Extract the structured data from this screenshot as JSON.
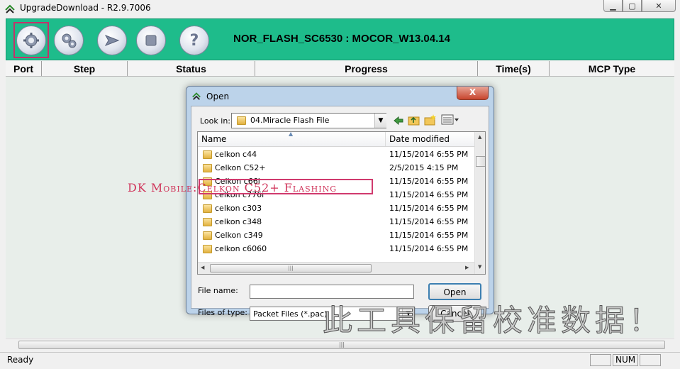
{
  "window": {
    "title": "UpgradeDownload - R2.9.7006",
    "min_label": "▁",
    "max_label": "▢",
    "close_label": "✕"
  },
  "toolbar": {
    "title": "NOR_FLASH_SC6530 : MOCOR_W13.04.14",
    "buttons": [
      "gear-icon",
      "gears-icon",
      "play-arrow-icon",
      "stop-icon",
      "help-icon"
    ]
  },
  "list": {
    "columns": [
      "Port",
      "Step",
      "Status",
      "Progress",
      "Time(s)",
      "MCP Type"
    ]
  },
  "statusbar": {
    "text": "Ready",
    "num": "NUM"
  },
  "overlay": {
    "watermark": "DK Mobile:Celkon C52+ Flashing",
    "chinese": "此工具保留校准数据！"
  },
  "dialog": {
    "title": "Open",
    "close_label": "X",
    "look_in_label": "Look in:",
    "look_in_value": "04.Miracle Flash File",
    "columns": {
      "name": "Name",
      "date": "Date modified"
    },
    "files": [
      {
        "name": "celkon c44",
        "date": "11/15/2014 6:55 PM"
      },
      {
        "name": "Celkon C52+",
        "date": "2/5/2015 4:15 PM"
      },
      {
        "name": "Celkon c66i",
        "date": "11/15/2014 6:55 PM"
      },
      {
        "name": "celkon c776i",
        "date": "11/15/2014 6:55 PM"
      },
      {
        "name": "celkon c303",
        "date": "11/15/2014 6:55 PM"
      },
      {
        "name": "celkon c348",
        "date": "11/15/2014 6:55 PM"
      },
      {
        "name": "Celkon c349",
        "date": "11/15/2014 6:55 PM"
      },
      {
        "name": "celkon c6060",
        "date": "11/15/2014 6:55 PM"
      }
    ],
    "file_name_label": "File name:",
    "file_name_value": "",
    "files_of_type_label": "Files of type:",
    "files_of_type_value": "Packet Files (*.pac)",
    "open_button": "Open",
    "cancel_button": "Cancel"
  }
}
